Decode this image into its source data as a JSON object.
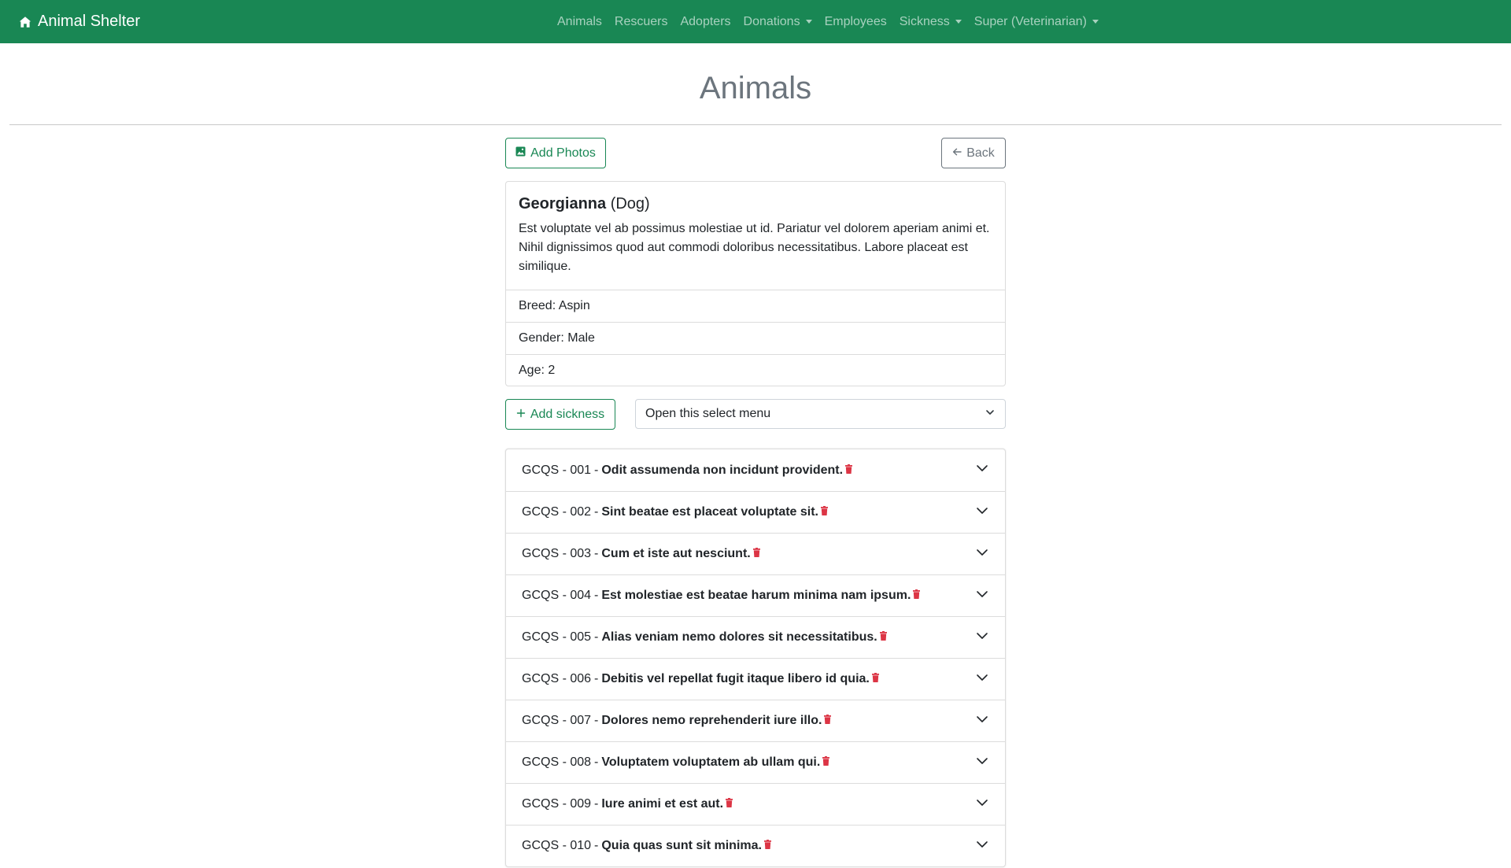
{
  "navbar": {
    "brand": "Animal Shelter",
    "brand_icon": "house-icon",
    "links": [
      {
        "label": "Animals",
        "dropdown": false
      },
      {
        "label": "Rescuers",
        "dropdown": false
      },
      {
        "label": "Adopters",
        "dropdown": false
      },
      {
        "label": "Donations",
        "dropdown": true
      },
      {
        "label": "Employees",
        "dropdown": false
      },
      {
        "label": "Sickness",
        "dropdown": true
      },
      {
        "label": "Super (Veterinarian)",
        "dropdown": true
      }
    ]
  },
  "page": {
    "title": "Animals"
  },
  "toolbar": {
    "add_photos_label": "Add Photos",
    "back_label": "Back"
  },
  "animal": {
    "name": "Georgianna",
    "species": "(Dog)",
    "description": "Est voluptate vel ab possimus molestiae ut id. Pariatur vel dolorem aperiam animi et. Nihil dignissimos quod aut commodi doloribus necessitatibus. Labore placeat est similique.",
    "breed": "Breed: Aspin",
    "gender": "Gender: Male",
    "age": "Age: 2"
  },
  "sickness_form": {
    "add_label": "Add sickness",
    "select_value": "Open this select menu"
  },
  "sicknesses": [
    {
      "code": "GCQS - 001",
      "name": "Odit assumenda non incidunt provident."
    },
    {
      "code": "GCQS - 002",
      "name": "Sint beatae est placeat voluptate sit."
    },
    {
      "code": "GCQS - 003",
      "name": "Cum et iste aut nesciunt."
    },
    {
      "code": "GCQS - 004",
      "name": "Est molestiae est beatae harum minima nam ipsum."
    },
    {
      "code": "GCQS - 005",
      "name": "Alias veniam nemo dolores sit necessitatibus."
    },
    {
      "code": "GCQS - 006",
      "name": "Debitis vel repellat fugit itaque libero id quia."
    },
    {
      "code": "GCQS - 007",
      "name": "Dolores nemo reprehenderit iure illo."
    },
    {
      "code": "GCQS - 008",
      "name": "Voluptatem voluptatem ab ullam qui."
    },
    {
      "code": "GCQS - 009",
      "name": "Iure animi et est aut."
    },
    {
      "code": "GCQS - 010",
      "name": "Quia quas sunt sit minima."
    }
  ],
  "colors": {
    "primary": "#198754",
    "danger": "#dc3545",
    "muted": "#6c757d"
  }
}
